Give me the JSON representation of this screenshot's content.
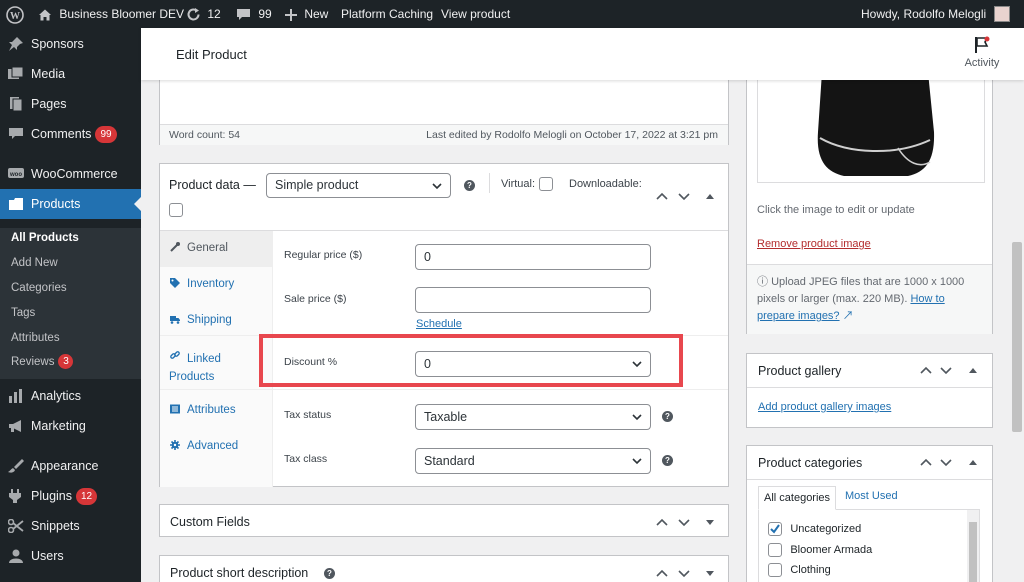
{
  "adminbar": {
    "site_name": "Business Bloomer DEV",
    "updates_count": "12",
    "comments_count": "99",
    "new_label": "New",
    "caching_label": "Platform Caching",
    "view_label": "View product",
    "howdy": "Howdy, Rodolfo Melogli"
  },
  "sidebar": {
    "items": [
      {
        "label": "Sponsors",
        "icon": "pin-icon"
      },
      {
        "label": "Media",
        "icon": "media-icon"
      },
      {
        "label": "Pages",
        "icon": "pages-icon"
      },
      {
        "label": "Comments",
        "icon": "comment-icon",
        "badge": "99"
      },
      {
        "label": "WooCommerce",
        "icon": "woo-icon"
      },
      {
        "label": "Products",
        "icon": "products-icon"
      },
      {
        "label": "Analytics",
        "icon": "analytics-icon"
      },
      {
        "label": "Marketing",
        "icon": "megaphone-icon"
      },
      {
        "label": "Appearance",
        "icon": "brush-icon"
      },
      {
        "label": "Plugins",
        "icon": "plugin-icon",
        "badge": "12"
      },
      {
        "label": "Snippets",
        "icon": "scissors-icon"
      },
      {
        "label": "Users",
        "icon": "user-icon"
      }
    ],
    "submenu": [
      {
        "label": "All Products"
      },
      {
        "label": "Add New"
      },
      {
        "label": "Categories"
      },
      {
        "label": "Tags"
      },
      {
        "label": "Attributes"
      },
      {
        "label": "Reviews",
        "badge": "3"
      }
    ]
  },
  "header": {
    "title": "Edit Product",
    "activity_label": "Activity"
  },
  "editor": {
    "word_count": "Word count: 54",
    "last_edited": "Last edited by Rodolfo Melogli on October 17, 2022 at 3:21 pm"
  },
  "product_data": {
    "title": "Product data —",
    "type_value": "Simple product",
    "virtual_label": "Virtual:",
    "downloadable_label": "Downloadable:",
    "tabs": [
      {
        "label": "General"
      },
      {
        "label": "Inventory"
      },
      {
        "label": "Shipping"
      },
      {
        "label": "Linked Products"
      },
      {
        "label": "Attributes"
      },
      {
        "label": "Advanced"
      }
    ],
    "regular_price_label": "Regular price ($)",
    "regular_price_value": "0",
    "sale_price_label": "Sale price ($)",
    "sale_price_value": "",
    "schedule_label": "Schedule",
    "discount_label": "Discount %",
    "discount_value": "0",
    "tax_status_label": "Tax status",
    "tax_status_value": "Taxable",
    "tax_class_label": "Tax class",
    "tax_class_value": "Standard"
  },
  "custom_fields": {
    "title": "Custom Fields"
  },
  "short_description": {
    "title": "Product short description"
  },
  "product_image": {
    "edit_hint": "Click the image to edit or update",
    "remove_label": "Remove product image",
    "upload_note": "Upload JPEG files that are 1000 x 1000 pixels or larger (max. 220 MB).",
    "upload_link": "How to prepare images?"
  },
  "gallery": {
    "title": "Product gallery",
    "add_label": "Add product gallery images"
  },
  "categories": {
    "title": "Product categories",
    "tab_all": "All categories",
    "tab_most": "Most Used",
    "items": [
      {
        "label": "Uncategorized",
        "checked": true
      },
      {
        "label": "Bloomer Armada",
        "checked": false
      },
      {
        "label": "Clothing",
        "checked": false
      }
    ]
  },
  "colors": {
    "accent": "#2271b1",
    "highlight_box": "#e8474e",
    "badge": "#d63638",
    "admin_dark": "#1d2327"
  }
}
